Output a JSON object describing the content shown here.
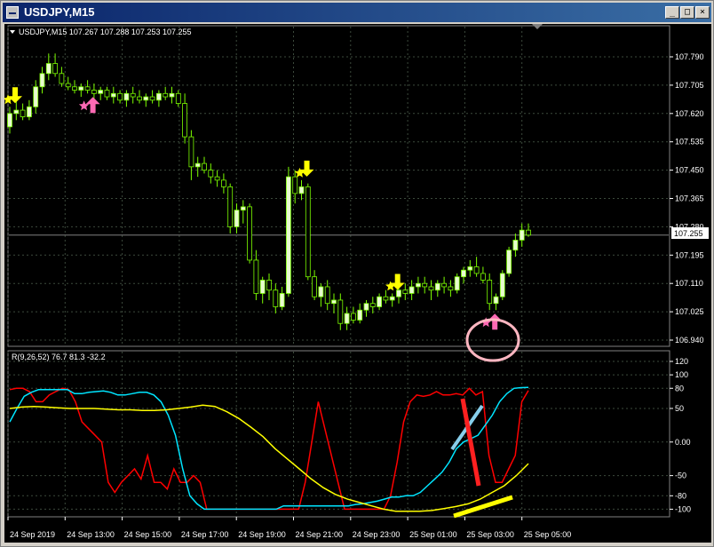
{
  "window": {
    "title": "USDJPY,M15",
    "buttons": {
      "minimize": "_",
      "maximize": "□",
      "close": "×"
    }
  },
  "colors": {
    "background": "#000000",
    "grid": "#3c4a3c",
    "bull_candle": "#e8fcd0",
    "bear_candle": "#000000",
    "wick": "#7cfc00",
    "indicator_fast": "#ff0000",
    "indicator_mid": "#00e5ff",
    "indicator_slow": "#ffff00",
    "arrow_sell": "#ffff00",
    "arrow_buy": "#ff69b4"
  },
  "price_panel": {
    "header": "USDJPY,M15  107.267 107.288 107.253 107.255",
    "current_price": "107.255",
    "y_labels": [
      "107.790",
      "107.705",
      "107.620",
      "107.535",
      "107.450",
      "107.365",
      "107.280",
      "107.195",
      "107.110",
      "107.025",
      "106.940"
    ]
  },
  "indicator_panel": {
    "header": "R(9,26,52) 76.7 81.3 -32.2",
    "y_labels": [
      "120",
      "100",
      "80",
      "50",
      "0.00",
      "-50",
      "-80",
      "-100"
    ]
  },
  "time_axis": {
    "labels": [
      "24 Sep 2019",
      "24 Sep 13:00",
      "24 Sep 15:00",
      "24 Sep 17:00",
      "24 Sep 19:00",
      "24 Sep 21:00",
      "24 Sep 23:00",
      "25 Sep 01:00",
      "25 Sep 03:00",
      "25 Sep 05:00"
    ]
  },
  "chart_data": [
    {
      "type": "candlestick",
      "symbol": "USDJPY",
      "timeframe": "M15",
      "ylim": [
        106.94,
        107.83
      ],
      "ohlc": [
        [
          107.58,
          107.64,
          107.56,
          107.62
        ],
        [
          107.62,
          107.66,
          107.6,
          107.63
        ],
        [
          107.63,
          107.65,
          107.6,
          107.61
        ],
        [
          107.61,
          107.66,
          107.6,
          107.64
        ],
        [
          107.64,
          107.72,
          107.62,
          107.7
        ],
        [
          107.7,
          107.76,
          107.68,
          107.74
        ],
        [
          107.74,
          107.8,
          107.72,
          107.77
        ],
        [
          107.77,
          107.8,
          107.73,
          107.74
        ],
        [
          107.74,
          107.76,
          107.7,
          107.71
        ],
        [
          107.71,
          107.73,
          107.69,
          107.7
        ],
        [
          107.7,
          107.72,
          107.68,
          107.69
        ],
        [
          107.69,
          107.71,
          107.67,
          107.7
        ],
        [
          107.7,
          107.72,
          107.68,
          107.69
        ],
        [
          107.69,
          107.71,
          107.66,
          107.68
        ],
        [
          107.68,
          107.7,
          107.66,
          107.69
        ],
        [
          107.69,
          107.7,
          107.66,
          107.67
        ],
        [
          107.67,
          107.7,
          107.65,
          107.68
        ],
        [
          107.68,
          107.69,
          107.65,
          107.66
        ],
        [
          107.66,
          107.69,
          107.64,
          107.68
        ],
        [
          107.68,
          107.7,
          107.65,
          107.67
        ],
        [
          107.67,
          107.69,
          107.65,
          107.66
        ],
        [
          107.66,
          107.68,
          107.64,
          107.67
        ],
        [
          107.67,
          107.69,
          107.65,
          107.66
        ],
        [
          107.66,
          107.69,
          107.64,
          107.68
        ],
        [
          107.68,
          107.7,
          107.66,
          107.67
        ],
        [
          107.67,
          107.7,
          107.65,
          107.68
        ],
        [
          107.68,
          107.69,
          107.64,
          107.65
        ],
        [
          107.65,
          107.68,
          107.53,
          107.55
        ],
        [
          107.55,
          107.57,
          107.42,
          107.46
        ],
        [
          107.46,
          107.49,
          107.43,
          107.47
        ],
        [
          107.47,
          107.49,
          107.44,
          107.45
        ],
        [
          107.45,
          107.47,
          107.41,
          107.43
        ],
        [
          107.43,
          107.45,
          107.4,
          107.42
        ],
        [
          107.42,
          107.44,
          107.38,
          107.4
        ],
        [
          107.4,
          107.41,
          107.26,
          107.28
        ],
        [
          107.28,
          107.35,
          107.26,
          107.33
        ],
        [
          107.33,
          107.36,
          107.29,
          107.34
        ],
        [
          107.34,
          107.35,
          107.17,
          107.18
        ],
        [
          107.18,
          107.21,
          107.06,
          107.08
        ],
        [
          107.08,
          107.13,
          107.05,
          107.12
        ],
        [
          107.12,
          107.14,
          107.06,
          107.09
        ],
        [
          107.09,
          107.11,
          107.02,
          107.04
        ],
        [
          107.04,
          107.1,
          107.03,
          107.08
        ],
        [
          107.08,
          107.46,
          107.07,
          107.43
        ],
        [
          107.43,
          107.45,
          107.35,
          107.38
        ],
        [
          107.38,
          107.42,
          107.36,
          107.4
        ],
        [
          107.4,
          107.41,
          107.12,
          107.13
        ],
        [
          107.13,
          107.15,
          107.06,
          107.07
        ],
        [
          107.07,
          107.11,
          107.04,
          107.1
        ],
        [
          107.1,
          107.12,
          107.03,
          107.05
        ],
        [
          107.05,
          107.08,
          107.02,
          107.06
        ],
        [
          107.06,
          107.08,
          106.97,
          106.99
        ],
        [
          106.99,
          107.04,
          106.97,
          107.02
        ],
        [
          107.02,
          107.04,
          106.99,
          107.0
        ],
        [
          107.0,
          107.05,
          106.99,
          107.03
        ],
        [
          107.03,
          107.06,
          107.01,
          107.05
        ],
        [
          107.05,
          107.07,
          107.02,
          107.04
        ],
        [
          107.04,
          107.08,
          107.03,
          107.07
        ],
        [
          107.07,
          107.09,
          107.05,
          107.06
        ],
        [
          107.06,
          107.08,
          107.04,
          107.07
        ],
        [
          107.07,
          107.1,
          107.05,
          107.09
        ],
        [
          107.09,
          107.11,
          107.06,
          107.08
        ],
        [
          107.08,
          107.12,
          107.06,
          107.1
        ],
        [
          107.1,
          107.13,
          107.08,
          107.11
        ],
        [
          107.11,
          107.13,
          107.08,
          107.1
        ],
        [
          107.1,
          107.12,
          107.06,
          107.09
        ],
        [
          107.09,
          107.12,
          107.07,
          107.11
        ],
        [
          107.11,
          107.13,
          107.08,
          107.1
        ],
        [
          107.1,
          107.12,
          107.07,
          107.09
        ],
        [
          107.09,
          107.14,
          107.08,
          107.13
        ],
        [
          107.13,
          107.16,
          107.11,
          107.15
        ],
        [
          107.15,
          107.18,
          107.13,
          107.16
        ],
        [
          107.16,
          107.19,
          107.13,
          107.14
        ],
        [
          107.14,
          107.16,
          107.11,
          107.12
        ],
        [
          107.12,
          107.14,
          107.03,
          107.05
        ],
        [
          107.05,
          107.08,
          107.03,
          107.07
        ],
        [
          107.07,
          107.15,
          107.06,
          107.14
        ],
        [
          107.14,
          107.22,
          107.13,
          107.21
        ],
        [
          107.21,
          107.26,
          107.19,
          107.24
        ],
        [
          107.24,
          107.29,
          107.22,
          107.27
        ],
        [
          107.27,
          107.29,
          107.25,
          107.255
        ]
      ],
      "signals": [
        {
          "type": "sell",
          "bar": 0
        },
        {
          "type": "buy",
          "bar": 12
        },
        {
          "type": "sell",
          "bar": 45
        },
        {
          "type": "sell",
          "bar": 59
        },
        {
          "type": "buy",
          "bar": 74
        }
      ]
    },
    {
      "type": "line",
      "title": "R(9,26,52) 76.7 81.3 -32.2",
      "ylim": [
        -110,
        120
      ],
      "series": [
        {
          "name": "9",
          "color": "#ff0000",
          "values": [
            78,
            80,
            80,
            75,
            60,
            60,
            70,
            75,
            80,
            78,
            60,
            30,
            20,
            10,
            0,
            -60,
            -75,
            -60,
            -50,
            -40,
            -55,
            -20,
            -60,
            -60,
            -70,
            -40,
            -60,
            -60,
            -50,
            -60,
            -100,
            -100,
            -100,
            -100,
            -100,
            -100,
            -100,
            -100,
            -100,
            -100,
            -100,
            -100,
            -100,
            -100,
            -100,
            -60,
            0,
            60,
            20,
            -20,
            -60,
            -100,
            -100,
            -100,
            -100,
            -100,
            -100,
            -100,
            -80,
            -30,
            30,
            60,
            70,
            68,
            70,
            75,
            70,
            70,
            72,
            70,
            80,
            70,
            75,
            -20,
            -60,
            -60,
            -40,
            -20,
            60,
            76.7
          ]
        },
        {
          "name": "26",
          "color": "#00e5ff",
          "values": [
            30,
            50,
            68,
            74,
            78,
            78,
            78,
            78,
            78,
            72,
            72,
            74,
            75,
            76,
            74,
            70,
            70,
            72,
            74,
            74,
            70,
            60,
            40,
            10,
            -40,
            -80,
            -92,
            -100,
            -100,
            -100,
            -100,
            -100,
            -100,
            -100,
            -100,
            -100,
            -100,
            -100,
            -95,
            -95,
            -95,
            -95,
            -95,
            -95,
            -95,
            -95,
            -95,
            -95,
            -93,
            -92,
            -90,
            -88,
            -85,
            -82,
            -82,
            -80,
            -80,
            -75,
            -65,
            -55,
            -45,
            -30,
            -10,
            0,
            5,
            10,
            25,
            40,
            60,
            72,
            80,
            81,
            81.3
          ]
        },
        {
          "name": "52",
          "color": "#ffff00",
          "values": [
            50,
            52,
            53,
            52,
            51,
            50,
            50,
            50,
            49,
            48,
            48,
            47,
            47,
            48,
            50,
            52,
            55,
            53,
            45,
            35,
            22,
            8,
            -10,
            -25,
            -40,
            -55,
            -68,
            -78,
            -85,
            -90,
            -95,
            -100,
            -103,
            -103,
            -103,
            -102,
            -99,
            -96,
            -92,
            -85,
            -75,
            -65,
            -50,
            -32.2
          ]
        }
      ]
    }
  ]
}
